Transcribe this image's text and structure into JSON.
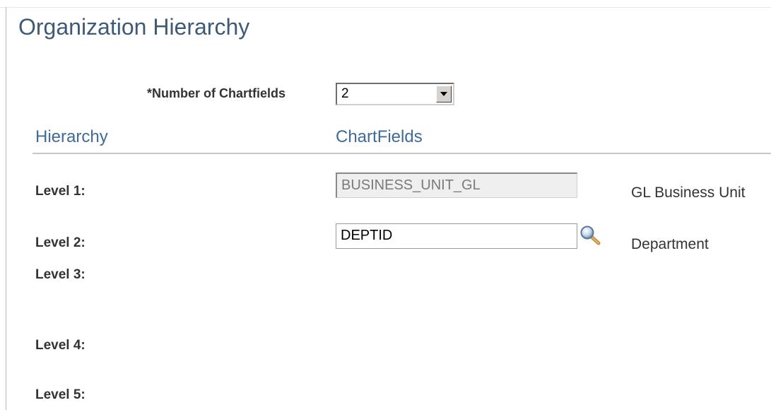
{
  "page": {
    "title": "Organization Hierarchy"
  },
  "number_of_chartfields": {
    "label": "*Number of Chartfields",
    "value": "2"
  },
  "grid": {
    "headers": {
      "hierarchy": "Hierarchy",
      "chartfields": "ChartFields"
    },
    "rows": [
      {
        "level": "Level 1:",
        "chartfield": "BUSINESS_UNIT_GL",
        "description": "GL Business Unit",
        "editable": false
      },
      {
        "level": "Level 2:",
        "chartfield": "DEPTID",
        "description": "Department",
        "editable": true
      },
      {
        "level": "Level 3:",
        "chartfield": "",
        "description": ""
      },
      {
        "level": "Level 4:",
        "chartfield": "",
        "description": ""
      },
      {
        "level": "Level 5:",
        "chartfield": "",
        "description": ""
      }
    ]
  },
  "icons": {
    "lookup": "magnifying-glass-icon",
    "dropdown": "chevron-down-icon"
  },
  "colors": {
    "title": "#3f5a76",
    "column_header": "#3e6a9c",
    "label": "#333333",
    "disabled_bg": "#efefef"
  }
}
